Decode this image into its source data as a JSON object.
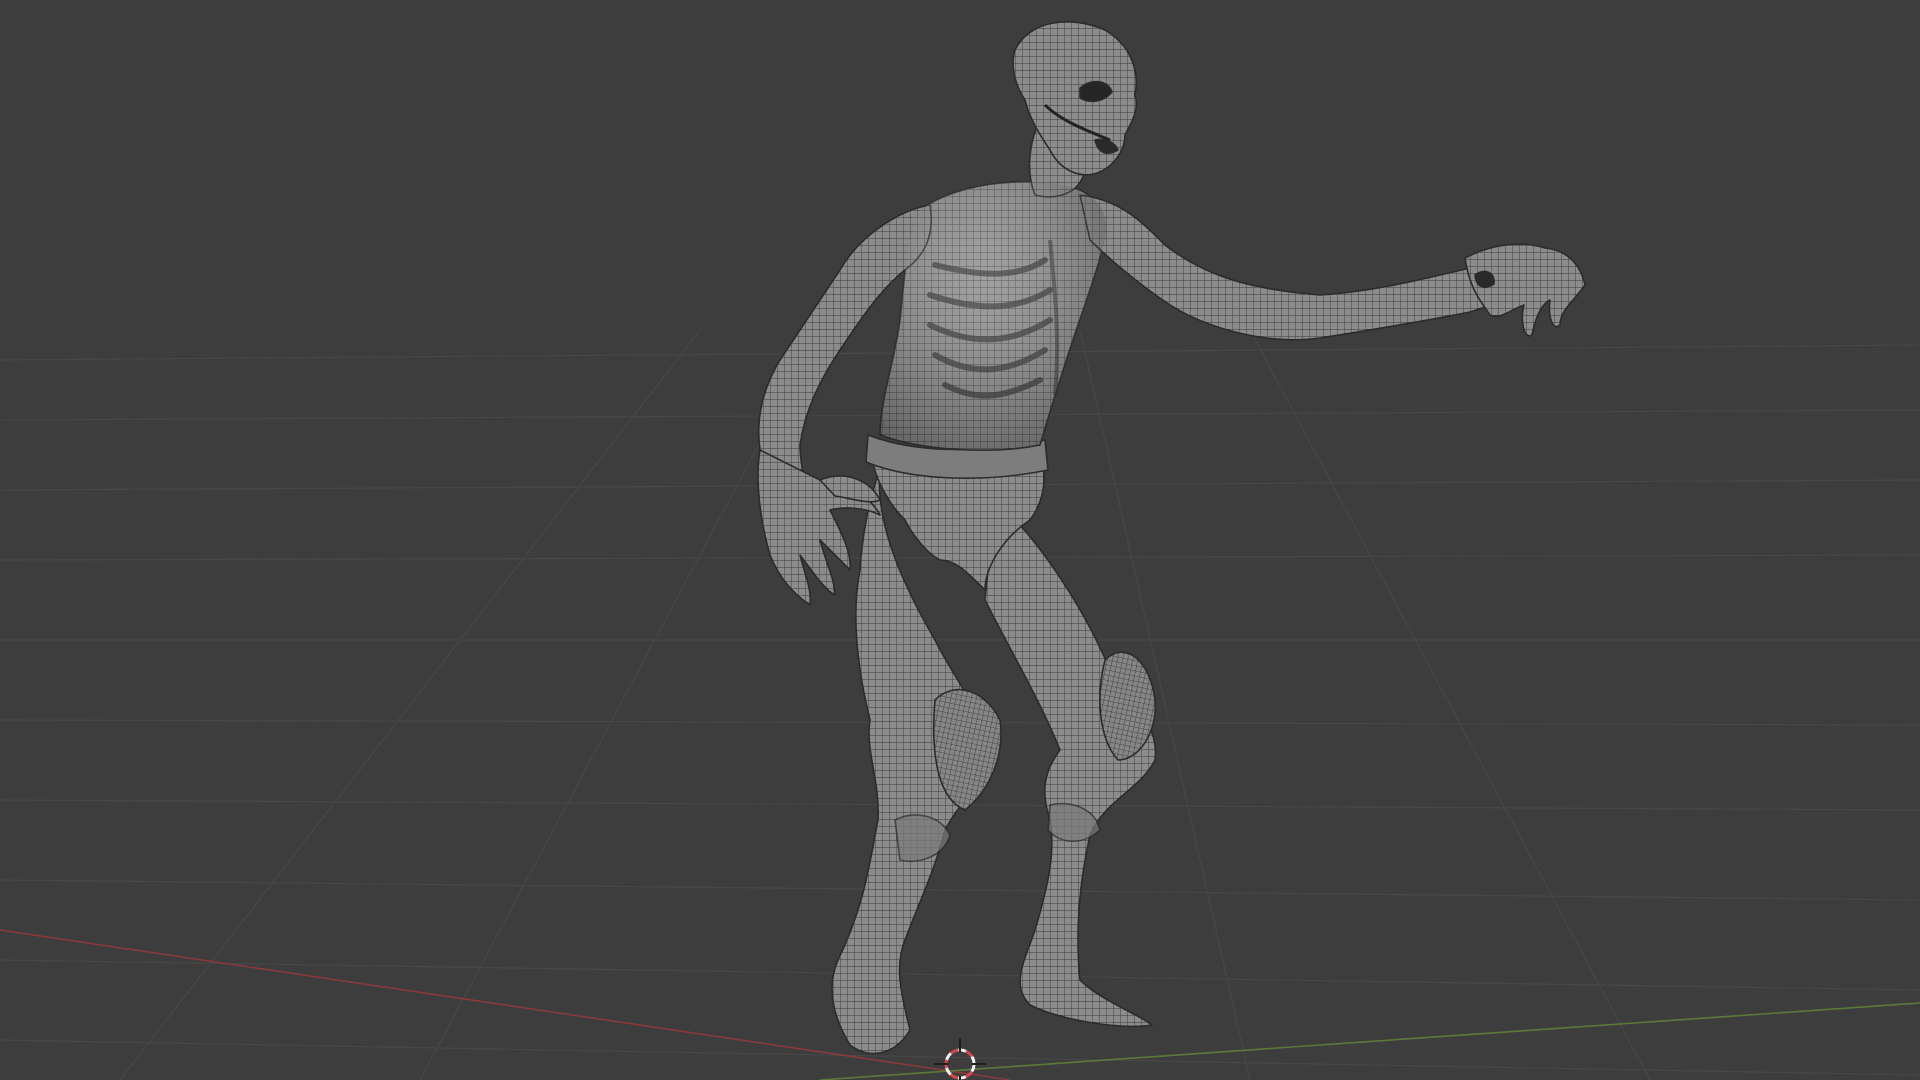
{
  "viewport": {
    "background_color": "#3d3d3d",
    "grid_color": "#4a4a4a",
    "x_axis_color": "#8a3a3a",
    "y_axis_color": "#5a7a3a",
    "grid_floor": "visible",
    "shading": "solid-wireframe"
  },
  "model": {
    "icon": "humanoid-undead-mesh",
    "base_color": "#8e8e8e",
    "wire_color": "#2e2e2e"
  },
  "cursor3d": {
    "icon": "3d-cursor-icon",
    "ring_color_a": "#d44a4a",
    "ring_color_b": "#f2f2f2"
  }
}
